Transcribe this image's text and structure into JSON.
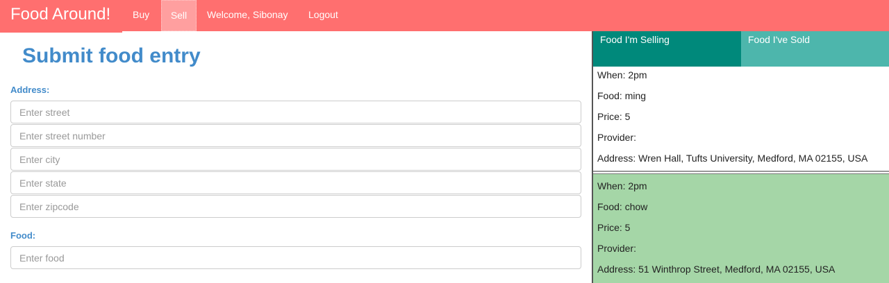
{
  "navbar": {
    "brand": "Food Around!",
    "links": [
      "Buy",
      "Sell",
      "Welcome, Sibonay",
      "Logout"
    ],
    "active": "Sell",
    "colors": {
      "bar": "#ff6f6f",
      "active_tab": "#ff9f9f"
    }
  },
  "form": {
    "title": "Submit food entry",
    "address_label": "Address:",
    "placeholders": {
      "street": "Enter street",
      "street_number": "Enter street number",
      "city": "Enter city",
      "state": "Enter state",
      "zipcode": "Enter zipcode",
      "food": "Enter food"
    },
    "food_label": "Food:",
    "accent": "#428bca"
  },
  "panel": {
    "tabs": [
      "Food I'm Selling",
      "Food I've Sold"
    ],
    "entries": [
      {
        "when": "When: 2pm",
        "food": "Food: ming",
        "price": "Price: 5",
        "provider": "Provider:",
        "address": "Address: Wren Hall, Tufts University, Medford, MA 02155, USA"
      },
      {
        "when": "When: 2pm",
        "food": "Food: chow",
        "price": "Price: 5",
        "provider": "Provider:",
        "address": "Address: 51 Winthrop Street, Medford, MA 02155, USA"
      }
    ],
    "colors": {
      "tab_selling": "#00897b",
      "tab_sold": "#4db6ac",
      "highlight": "#a5d6a7"
    }
  }
}
